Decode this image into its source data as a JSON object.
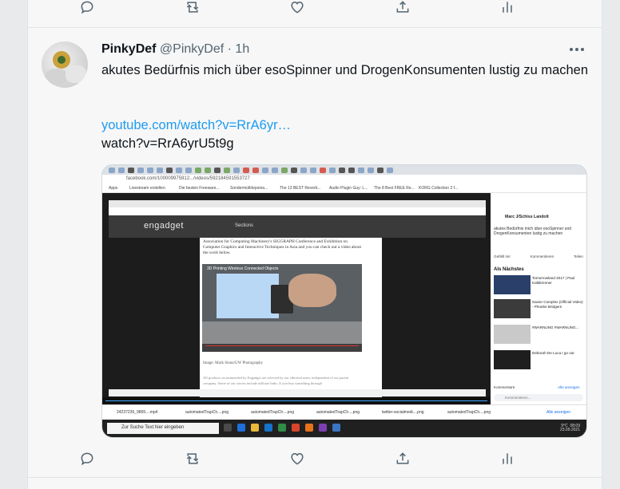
{
  "tweet": {
    "display_name": "PinkyDef",
    "handle": "@PinkyDef",
    "separator": "·",
    "time": "1h",
    "text": "akutes Bedürfnis mich über esoSpinner und DrogenKonsumenten lustig zu machen",
    "link_display": "youtube.com/watch?v=RrA6yr…",
    "link_full_line": "watch?v=RrA6yrU5t9g"
  },
  "actions": [
    "reply",
    "retweet",
    "like",
    "share",
    "analytics"
  ],
  "screenshot": {
    "url": "facebook.com/100009975912.../videos/592184591553727",
    "bookmarks": [
      "Apps",
      "Livestream erstellen",
      "Die besten Freeware...",
      "Sondermülldeponia...",
      "The 13 BEST Reverb...",
      "Audio Plugin Guy: L...",
      "The 8 Best FREE Re...",
      "KORG Collection 2 f..."
    ],
    "engadget_logo": "engadget",
    "engadget_nav": "Sections",
    "article_para1": "Association for Computing Machinery's SIGGRAPH Conference and Exhibition on Computer Graphics and Interactive Techniques in Asia and you can check out a video about the work below.",
    "video_title": "3D Printing Wireless Connected Objects",
    "caption": "Image: Mark Stone/UW Photography",
    "article_para2": "All products recommended by Engadget are selected by our editorial team, independent of our parent company. Some of our stories include affiliate links. If you buy something through",
    "fb_poster": "Marc J/Schiss Landolt",
    "fb_post_text": "akutes Bedürfnis mich über esoSpinner und DrogenKonsumenten lustig zu machen",
    "fb_like": "Gefällt mir",
    "fb_comment": "Kommentieren",
    "fb_share": "Teilen",
    "fb_next": "Als Nächstes",
    "fb_videos": [
      {
        "title": "Tomorrowland 2017 | Paul Kalkbrenner"
      },
      {
        "title": "Savior Complex (Official Video) - Phoebe Bridgers"
      },
      {
        "title": "#WARNUNG #WARNUNG..."
      },
      {
        "title": "Deborah De Luca I go out"
      }
    ],
    "fb_comments_label": "Kommentare",
    "fb_comments_all": "Alle anzeigen",
    "fb_comment_placeholder": "Kommentieren...",
    "downloads": [
      "automatedTrapCh....png",
      "automatedTrapCh....png",
      "automatedTrapCh....png",
      "twitter-socialmedi....png",
      "automatedTrapCh....png"
    ],
    "downloads_first": "24237236_9865....mp4",
    "downloads_showall": "Alle anzeigen",
    "taskbar_search": "Zur Suche Text hier eingeben",
    "tray_time": "08:09",
    "tray_date": "23.09.2021",
    "tray_temp": "9°C"
  }
}
